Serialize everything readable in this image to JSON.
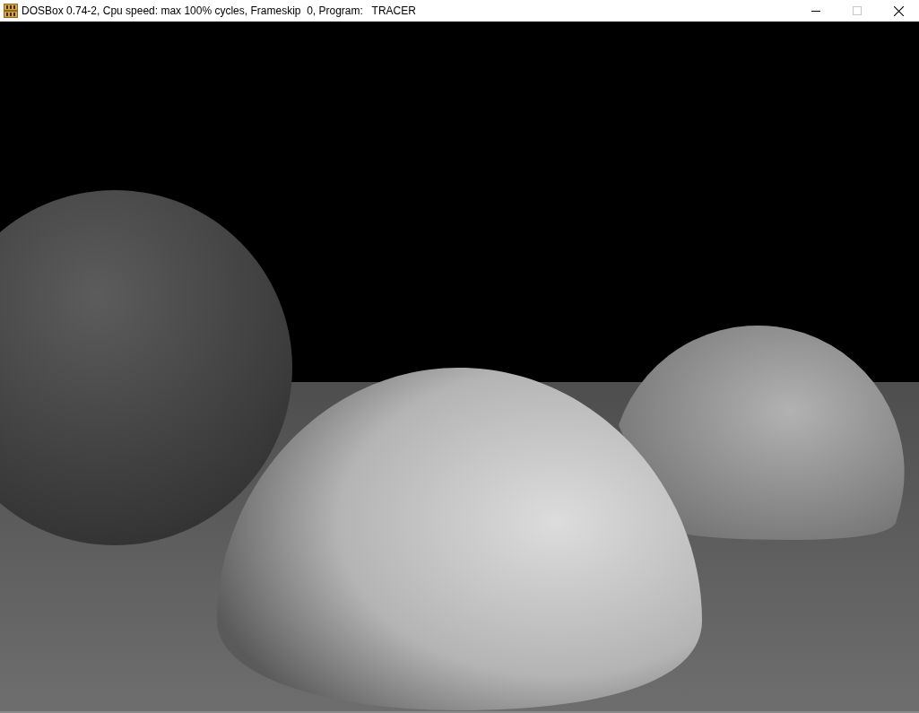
{
  "window": {
    "title": "DOSBox 0.74-2, Cpu speed: max 100% cycles, Frameskip  0, Program:   TRACER",
    "maximize_disabled": true
  }
}
